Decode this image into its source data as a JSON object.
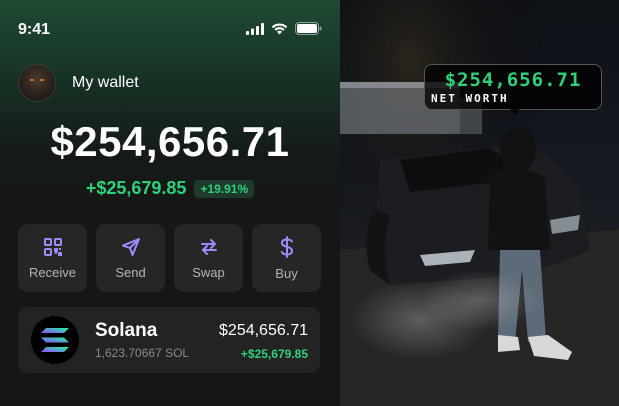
{
  "status_bar": {
    "time": "9:41"
  },
  "wallet": {
    "title": "My wallet",
    "balance": "$254,656.71",
    "change_amount": "+$25,679.85",
    "change_percent": "+19.91%"
  },
  "actions": [
    {
      "label": "Receive",
      "icon": "qr-code-icon"
    },
    {
      "label": "Send",
      "icon": "send-arrow-icon"
    },
    {
      "label": "Swap",
      "icon": "swap-arrows-icon"
    },
    {
      "label": "Buy",
      "icon": "dollar-icon"
    }
  ],
  "asset": {
    "name": "Solana",
    "amount": "1,623.70667 SOL",
    "value": "$254,656.71",
    "change": "+$25,679.85",
    "icon": "solana-logo-icon"
  },
  "photo_overlay": {
    "value": "$254,656.71",
    "caption": "NET WORTH"
  },
  "colors": {
    "accent_green": "#2fd07a",
    "card_bg": "#262626",
    "accent_purple": "#9b8cff"
  }
}
